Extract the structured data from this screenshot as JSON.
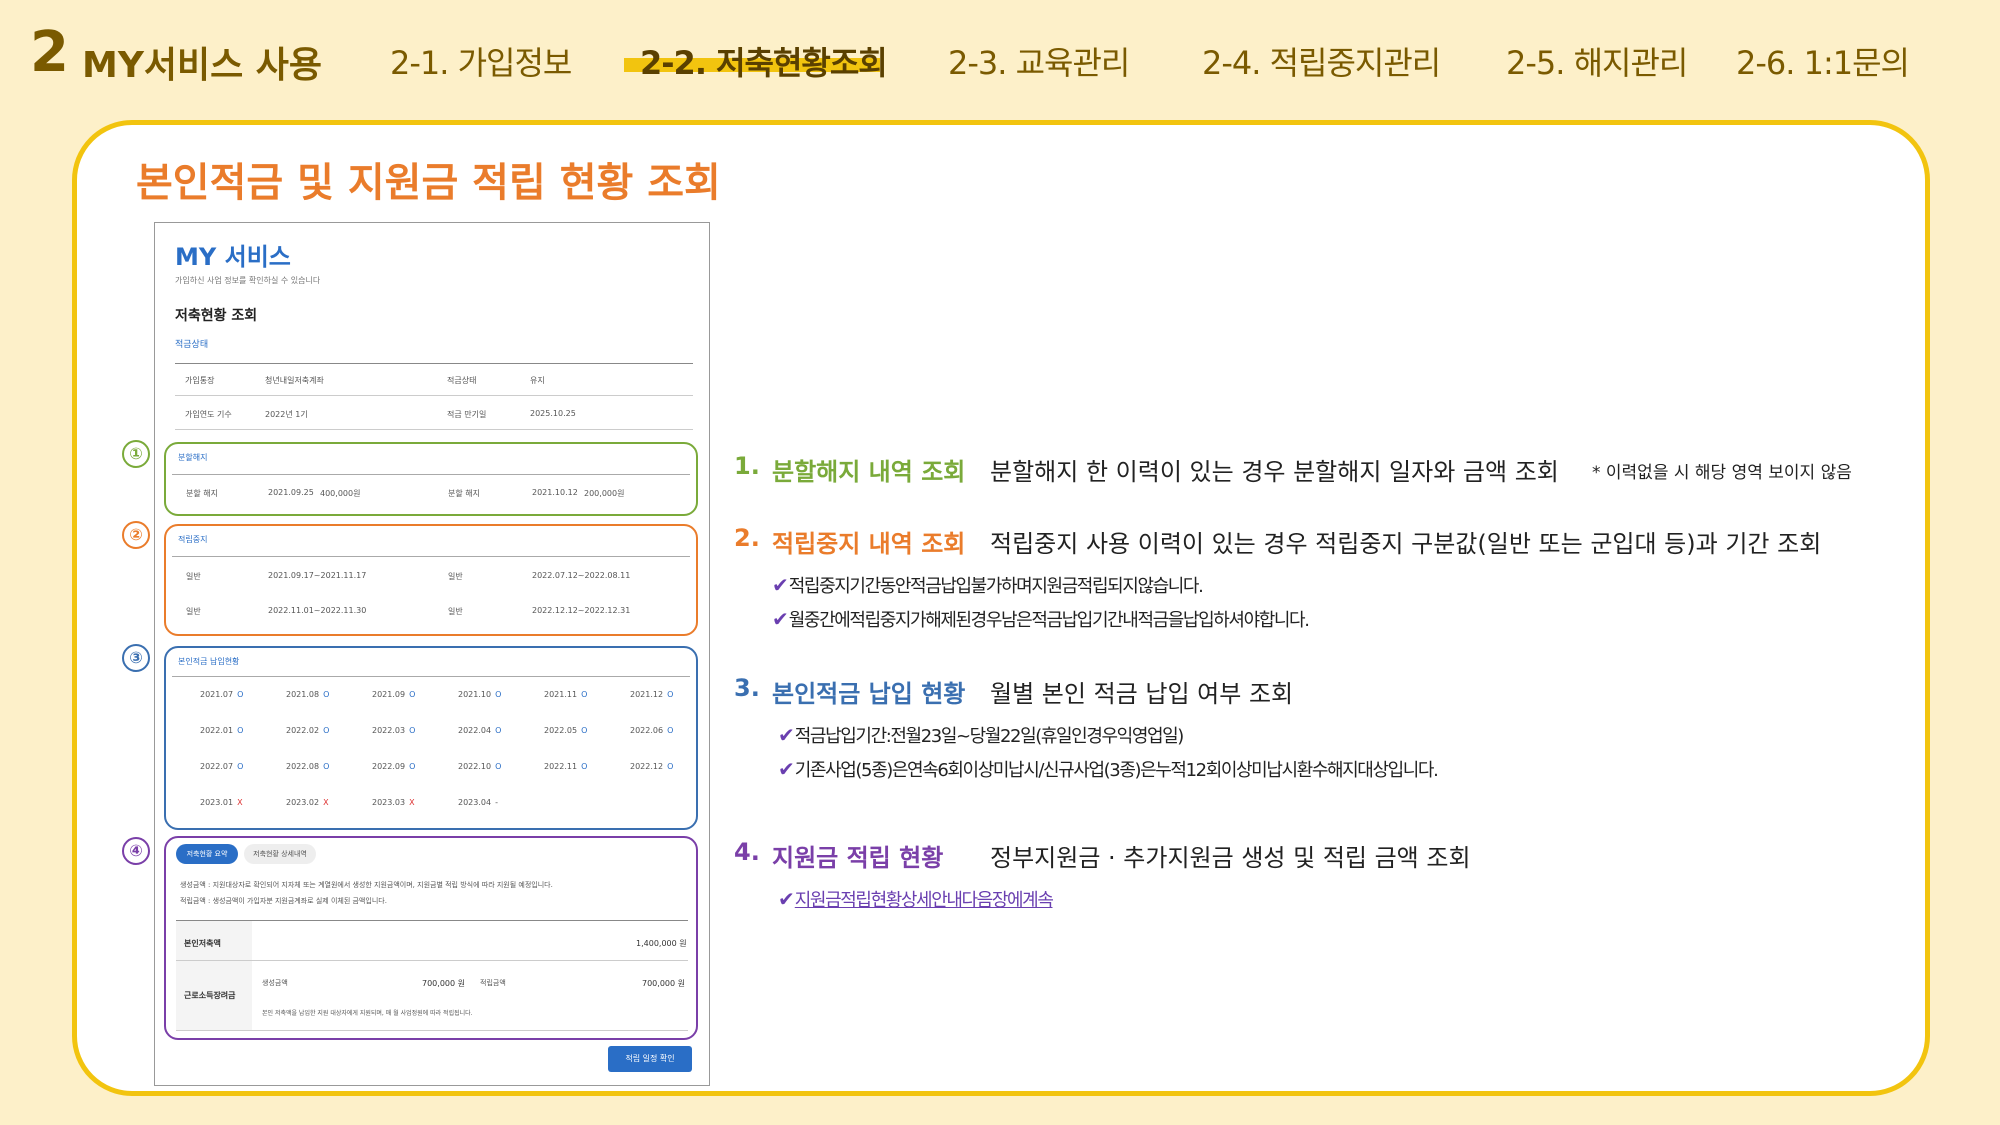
{
  "header": {
    "section_number": "2",
    "section_title": "MY서비스 사용",
    "nav": [
      "2-1. 가입정보",
      "2-2. 저축현황조회",
      "2-3. 교육관리",
      "2-4. 적립중지관리",
      "2-5. 해지관리",
      "2-6. 1:1문의"
    ],
    "active_nav": "2-2. 저축현황조회",
    "highlight_color": "#f2c40f"
  },
  "card": {
    "title": "본인적금 및 지원금 적립 현황 조회"
  },
  "screenshot": {
    "title": "MY 서비스",
    "subtitle": "가입하신 사업 정보를 확인하실 수 있습니다",
    "heading": "저축현황 조회",
    "status_label": "적금상태",
    "info_rows": [
      [
        "가입통장",
        "청년내일저축계좌",
        "적금상태",
        "유지"
      ],
      [
        "가입연도 기수",
        "2022년 1기",
        "적금 만기일",
        "2025.10.25"
      ]
    ],
    "split": {
      "label": "분할해지",
      "rows": [
        [
          "분할 해지",
          "2021.09.25",
          "400,000원",
          "분할 해지",
          "2021.10.12",
          "200,000원"
        ]
      ]
    },
    "suspend": {
      "label": "적립중지",
      "rows": [
        [
          "일반",
          "2021.09.17~2021.11.17",
          "일반",
          "2022.07.12~2022.08.11"
        ],
        [
          "일반",
          "2022.11.01~2022.11.30",
          "일반",
          "2022.12.12~2022.12.31"
        ]
      ]
    },
    "payment": {
      "label": "본인적금 납입현황",
      "months": [
        [
          "2021.07",
          "O"
        ],
        [
          "2021.08",
          "O"
        ],
        [
          "2021.09",
          "O"
        ],
        [
          "2021.10",
          "O"
        ],
        [
          "2021.11",
          "O"
        ],
        [
          "2021.12",
          "O"
        ],
        [
          "2022.01",
          "O"
        ],
        [
          "2022.02",
          "O"
        ],
        [
          "2022.03",
          "O"
        ],
        [
          "2022.04",
          "O"
        ],
        [
          "2022.05",
          "O"
        ],
        [
          "2022.06",
          "O"
        ],
        [
          "2022.07",
          "O"
        ],
        [
          "2022.08",
          "O"
        ],
        [
          "2022.09",
          "O"
        ],
        [
          "2022.10",
          "O"
        ],
        [
          "2022.11",
          "O"
        ],
        [
          "2022.12",
          "O"
        ],
        [
          "2023.01",
          "X"
        ],
        [
          "2023.02",
          "X"
        ],
        [
          "2023.03",
          "X"
        ],
        [
          "2023.04",
          "-"
        ]
      ]
    },
    "support": {
      "tab1": "저축현황 요약",
      "tab2": "저축현황 상세내역",
      "note1": "생성금액 : 지원대상자로 확인되어 지자체 또는 계열원에서 생성한 지원금액이며, 지원금별 적립 방식에 따라 지원될 예정입니다.",
      "note2": "적립금액 : 생성금액이 가입자분 지원금계좌로 실제 이체된 금액입니다.",
      "row1_label": "본인저축액",
      "row1_value": "1,400,000 원",
      "row2_label": "근로소득장려금",
      "gen_label": "생성금액",
      "gen_value": "700,000 원",
      "acc_label": "적립금액",
      "acc_value": "700,000 원",
      "row2_note": "본인 저축액을 납입한 지원 대상자에게 지원되며, 매 월 사업정원에 따라 적립됩니다.",
      "button": "적립 일정 확인"
    }
  },
  "items": [
    {
      "number": "1.",
      "heading": "분할해지 내역 조회",
      "desc": "분할해지 한 이력이 있는 경우 분할해지 일자와 금액 조회",
      "extra": "* 이력없을 시 해당 영역 보이지 않음",
      "color": "#7aaa3a",
      "notes": []
    },
    {
      "number": "2.",
      "heading": "적립중지 내역 조회",
      "desc": "적립중지 사용 이력이 있는 경우 적립중지 구분값(일반 또는 군입대 등)과 기간 조회",
      "color": "#ea7c2b",
      "notes": [
        "적립중지기간동안적금납입불가하며지원금적립되지않습니다.",
        "월중간에적립중지가해제된경우남은적금납입기간내적금을납입하셔야합니다."
      ]
    },
    {
      "number": "3.",
      "heading": "본인적금 납입 현황",
      "desc": "월별 본인 적금 납입 여부 조회",
      "color": "#3a6fb0",
      "notes": [
        "적금납입기간:전월23일~당월22일(휴일인경우익영업일)",
        "기존사업(5종)은연속6회이상미납시/신규사업(3종)은누적12회이상미납시환수해지대상입니다."
      ]
    },
    {
      "number": "4.",
      "heading": "지원금 적립 현황",
      "desc": "정부지원금 · 추가지원금 생성 및 적립 금액 조회",
      "color": "#7a3fa8",
      "notes": [
        "지원금적립현황상세안내다음장에계속"
      ]
    }
  ],
  "circles": [
    "①",
    "②",
    "③",
    "④"
  ]
}
